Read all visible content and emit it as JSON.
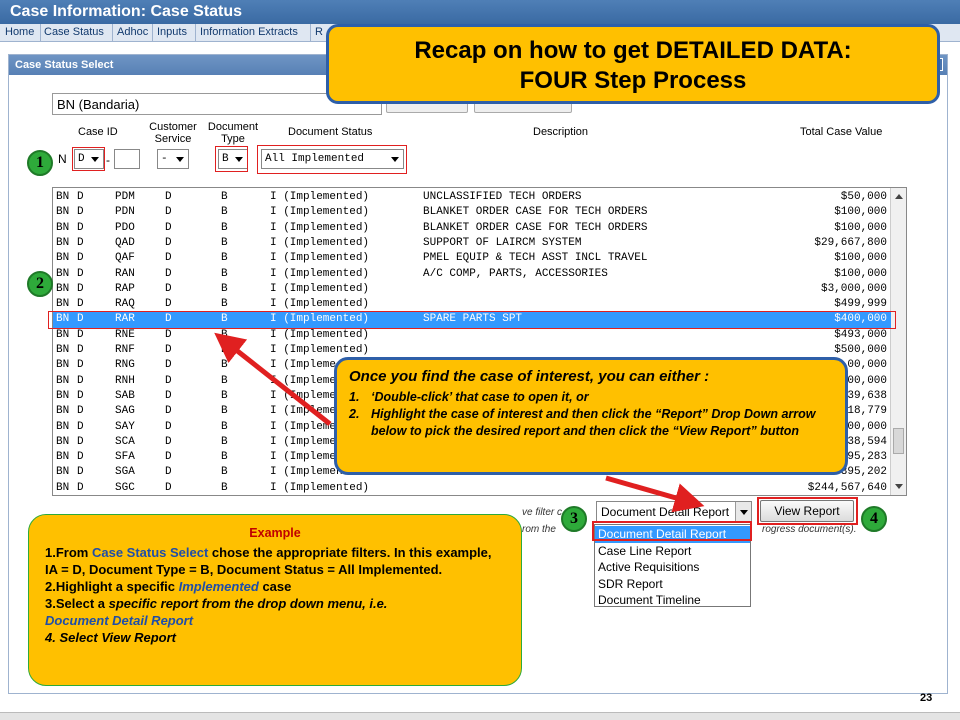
{
  "app": {
    "title": "Case Information: Case Status"
  },
  "menu": [
    "Home",
    "Case Status",
    "Adhoc",
    "Inputs",
    "Information Extracts",
    "R"
  ],
  "panel": {
    "title": "Case Status Select"
  },
  "filters": {
    "country": "BN (Bandaria)",
    "headers": {
      "case_id": "Case ID",
      "customer_service": [
        "Customer",
        "Service"
      ],
      "document_type": [
        "Document",
        "Type"
      ],
      "document_status": "Document Status",
      "description": "Description",
      "total_case_value": "Total Case Value"
    },
    "case_prefix": "N",
    "case_id_value": "D",
    "customer_service_value": "-",
    "document_type_value": "B",
    "document_status_value": "All Implemented"
  },
  "rows": [
    {
      "c": "BN",
      "d": "D",
      "case": "PDM",
      "ci": "D",
      "dt": "B",
      "st": "I (Implemented)",
      "desc": "UNCLASSIFIED TECH ORDERS",
      "val": "$50,000"
    },
    {
      "c": "BN",
      "d": "D",
      "case": "PDN",
      "ci": "D",
      "dt": "B",
      "st": "I (Implemented)",
      "desc": "BLANKET ORDER CASE FOR TECH ORDERS",
      "val": "$100,000"
    },
    {
      "c": "BN",
      "d": "D",
      "case": "PDO",
      "ci": "D",
      "dt": "B",
      "st": "I (Implemented)",
      "desc": "BLANKET ORDER CASE FOR TECH ORDERS",
      "val": "$100,000"
    },
    {
      "c": "BN",
      "d": "D",
      "case": "QAD",
      "ci": "D",
      "dt": "B",
      "st": "I (Implemented)",
      "desc": "SUPPORT OF LAIRCM SYSTEM",
      "val": "$29,667,800"
    },
    {
      "c": "BN",
      "d": "D",
      "case": "QAF",
      "ci": "D",
      "dt": "B",
      "st": "I (Implemented)",
      "desc": "PMEL EQUIP & TECH ASST INCL TRAVEL",
      "val": "$100,000"
    },
    {
      "c": "BN",
      "d": "D",
      "case": "RAN",
      "ci": "D",
      "dt": "B",
      "st": "I (Implemented)",
      "desc": "A/C COMP, PARTS, ACCESSORIES",
      "val": "$100,000"
    },
    {
      "c": "BN",
      "d": "D",
      "case": "RAP",
      "ci": "D",
      "dt": "B",
      "st": "I (Implemented)",
      "desc": "",
      "val": "$3,000,000"
    },
    {
      "c": "BN",
      "d": "D",
      "case": "RAQ",
      "ci": "D",
      "dt": "B",
      "st": "I (Implemented)",
      "desc": "",
      "val": "$499,999"
    },
    {
      "c": "BN",
      "d": "D",
      "case": "RAR",
      "ci": "D",
      "dt": "B",
      "st": "I (Implemented)",
      "desc": "SPARE PARTS SPT",
      "val": "$400,000"
    },
    {
      "c": "BN",
      "d": "D",
      "case": "RNE",
      "ci": "D",
      "dt": "B",
      "st": "I (Implemented)",
      "desc": "",
      "val": "$493,000"
    },
    {
      "c": "BN",
      "d": "D",
      "case": "RNF",
      "ci": "D",
      "dt": "B",
      "st": "I (Implemented)",
      "desc": "",
      "val": "$500,000"
    },
    {
      "c": "BN",
      "d": "D",
      "case": "RNG",
      "ci": "D",
      "dt": "B",
      "st": "I (Impleme",
      "desc": "",
      "val": "00,000"
    },
    {
      "c": "BN",
      "d": "D",
      "case": "RNH",
      "ci": "D",
      "dt": "B",
      "st": "I (Impleme",
      "desc": "",
      "val": "00,000"
    },
    {
      "c": "BN",
      "d": "D",
      "case": "SAB",
      "ci": "D",
      "dt": "B",
      "st": "I (Impleme",
      "desc": "",
      "val": "39,638"
    },
    {
      "c": "BN",
      "d": "D",
      "case": "SAG",
      "ci": "D",
      "dt": "B",
      "st": "I (Impleme",
      "desc": "",
      "val": "18,779"
    },
    {
      "c": "BN",
      "d": "D",
      "case": "SAY",
      "ci": "D",
      "dt": "B",
      "st": "I (Impleme",
      "desc": "",
      "val": "00,000"
    },
    {
      "c": "BN",
      "d": "D",
      "case": "SCA",
      "ci": "D",
      "dt": "B",
      "st": "I (Impleme",
      "desc": "",
      "val": "38,594"
    },
    {
      "c": "BN",
      "d": "D",
      "case": "SFA",
      "ci": "D",
      "dt": "B",
      "st": "I (Impleme",
      "desc": "",
      "val": "95,283"
    },
    {
      "c": "BN",
      "d": "D",
      "case": "SGA",
      "ci": "D",
      "dt": "B",
      "st": "I (Implemen",
      "desc": "",
      "val": "395,202"
    },
    {
      "c": "BN",
      "d": "D",
      "case": "SGC",
      "ci": "D",
      "dt": "B",
      "st": "I (Implemented)",
      "desc": "",
      "val": "$244,567,640"
    }
  ],
  "selected_row_index": 8,
  "callouts": {
    "top": {
      "line1": "Recap on how to get DETAILED DATA:",
      "line2": "FOUR Step Process"
    },
    "mid": {
      "head": "Once you find the case of interest, you can either :",
      "item1_num": "1.",
      "item1": "‘Double-click’ that case to open it, or",
      "item2_num": "2.",
      "item2": "Highlight the case of interest  and then click the “Report” Drop Down arrow below to pick the desired report and then click the “View Report” button"
    },
    "example": {
      "title": "Example",
      "s1a": "1.From ",
      "s1b": "Case Status Select",
      "s1c": " chose the appropriate filters. In this example,  IA = D, Document Type = B, Document Status =  All Implemented.",
      "s2a": "2.Highlight a specific ",
      "s2b": "Implemented",
      "s2c": " case",
      "s3a": "3.Select a ",
      "s3b": "specific report from the drop down menu, i.e.",
      "s3c": "Document Detail Report",
      "s4": "4. Select View Report"
    }
  },
  "steps": [
    "1",
    "2",
    "3",
    "4"
  ],
  "report": {
    "selected": "Document Detail Report",
    "options": [
      "Document Detail Report",
      "Case Line Report",
      "Active Requisitions",
      "SDR Report",
      "Document Timeline"
    ],
    "view_button": "View Report"
  },
  "bottom_text": {
    "a": "ve filter c",
    "b": "rom the",
    "c": "rogress document(s)."
  },
  "page_number": "23",
  "colors": {
    "callout_fill": "#ffc000",
    "callout_border": "#2e5fa8",
    "step_badge": "#2eaa3a",
    "highlight_red": "#e02020",
    "selection_blue": "#3399ff"
  }
}
